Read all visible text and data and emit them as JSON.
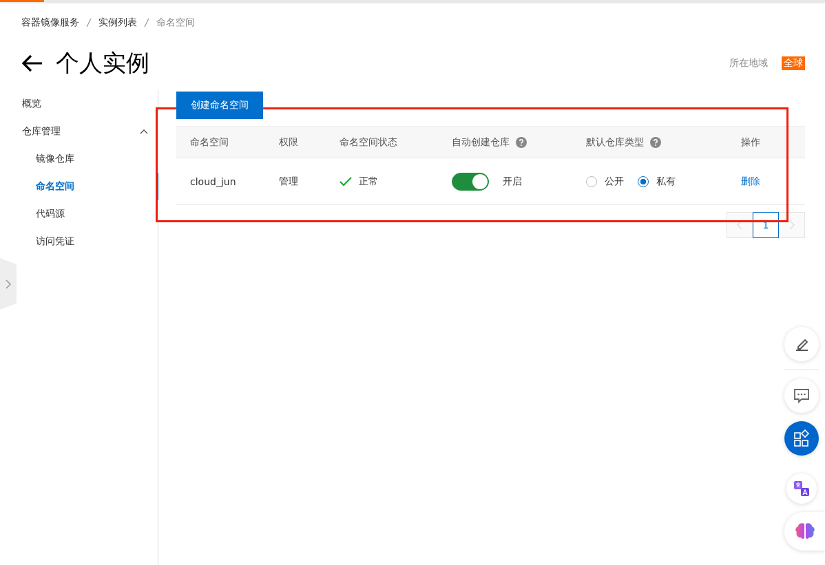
{
  "breadcrumb": [
    {
      "label": "容器镜像服务",
      "current": false
    },
    {
      "label": "实例列表",
      "current": false
    },
    {
      "label": "命名空间",
      "current": true
    }
  ],
  "page_title": "个人实例",
  "region": {
    "label": "所在地域",
    "value": "全球"
  },
  "sidebar": {
    "items": [
      {
        "label": "概览",
        "selected": false
      },
      {
        "label": "仓库管理",
        "selected": false,
        "expanded": true,
        "children": [
          {
            "label": "镜像仓库",
            "selected": false
          },
          {
            "label": "命名空间",
            "selected": true
          },
          {
            "label": "代码源",
            "selected": false
          },
          {
            "label": "访问凭证",
            "selected": false
          }
        ]
      }
    ]
  },
  "create_button": "创建命名空间",
  "table": {
    "columns": [
      {
        "label": "命名空间",
        "help": false
      },
      {
        "label": "权限",
        "help": false
      },
      {
        "label": "命名空间状态",
        "help": false
      },
      {
        "label": "自动创建仓库",
        "help": true
      },
      {
        "label": "默认仓库类型",
        "help": true
      },
      {
        "label": "操作",
        "help": false
      }
    ],
    "rows": [
      {
        "namespace": "cloud_jun",
        "permission": "管理",
        "status": {
          "label": "正常",
          "ok": true
        },
        "auto_create": {
          "on": true,
          "label": "开启"
        },
        "repo_type": [
          {
            "label": "公开",
            "selected": false
          },
          {
            "label": "私有",
            "selected": true
          }
        ],
        "action": "删除"
      }
    ]
  },
  "pagination": {
    "pages": [
      {
        "label": "1",
        "selected": true
      }
    ]
  }
}
